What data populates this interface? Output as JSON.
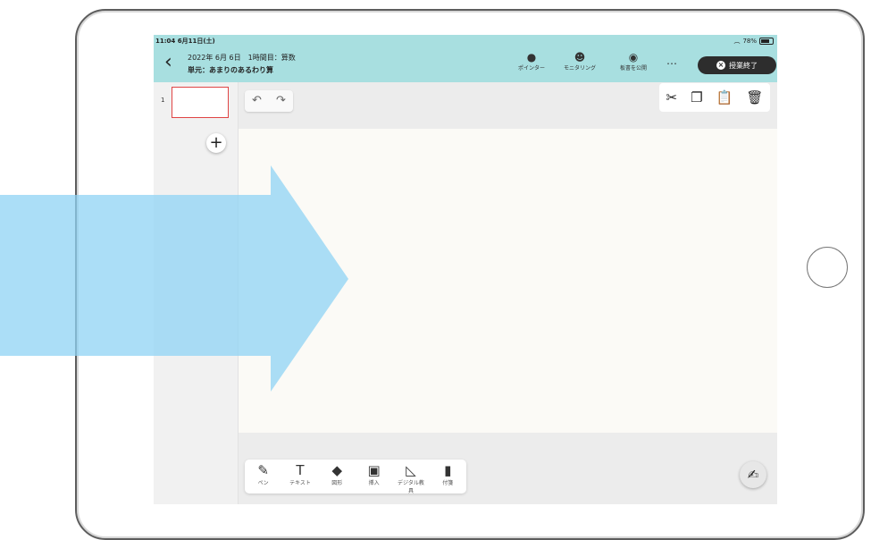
{
  "status": {
    "time": "11:04",
    "date": "6月11日(土)",
    "battery": "78%"
  },
  "header": {
    "lesson_title": "2022年 6月 6日　1時間目：算数",
    "lesson_unit": "単元：あまりのあるわり算",
    "tools": [
      {
        "label": "ポインター",
        "icon": "pointer-icon"
      },
      {
        "label": "モニタリング",
        "icon": "monitoring-face-icon"
      },
      {
        "label": "板書を公開",
        "icon": "eye-icon"
      }
    ],
    "more": "…",
    "end_label": "授業終了"
  },
  "sidebar": {
    "page_number": "1",
    "add_icon": "plus-icon"
  },
  "canvas": {
    "undo_icon": "undo-icon",
    "redo_icon": "redo-icon",
    "edit_tools": [
      "scissors-icon",
      "copy-icon",
      "paste-icon",
      "trash-icon"
    ]
  },
  "toolbox": {
    "items": [
      {
        "label": "ペン",
        "icon": "pen-icon"
      },
      {
        "label": "テキスト",
        "icon": "text-icon"
      },
      {
        "label": "図形",
        "icon": "shape-icon"
      },
      {
        "label": "挿入",
        "icon": "image-icon"
      },
      {
        "label": "デジタル教具",
        "icon": "ruler-icon"
      },
      {
        "label": "付箋",
        "icon": "bookmark-icon"
      }
    ]
  },
  "overlay": {
    "arrow_color": "#8fd3f4"
  }
}
